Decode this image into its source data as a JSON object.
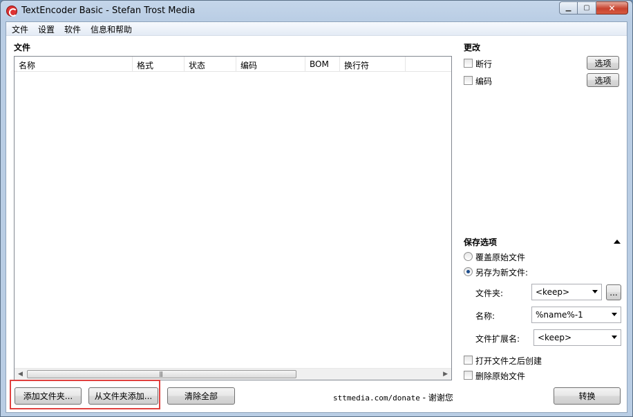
{
  "window": {
    "title": "TextEncoder Basic - Stefan Trost Media"
  },
  "menubar": {
    "items": [
      "文件",
      "设置",
      "软件",
      "信息和帮助"
    ]
  },
  "files_section": {
    "title": "文件",
    "columns": [
      "名称",
      "格式",
      "状态",
      "编码",
      "BOM",
      "换行符"
    ],
    "rows": []
  },
  "changes_section": {
    "title": "更改",
    "options": [
      {
        "label": "断行",
        "checked": false,
        "button": "选项"
      },
      {
        "label": "编码",
        "checked": false,
        "button": "选项"
      }
    ]
  },
  "save_section": {
    "title": "保存选项",
    "radio_overwrite": "覆盖原始文件",
    "radio_save_new": "另存为新文件:",
    "selected": "save_new",
    "folder_label": "文件夹:",
    "folder_value": "<keep>",
    "browse_label": "...",
    "name_label": "名称:",
    "name_value": "%name%-1",
    "ext_label": "文件扩展名:",
    "ext_value": "<keep>",
    "create_after_open": "打开文件之后创建",
    "delete_original": "删除原始文件"
  },
  "bottom": {
    "add_files": "添加文件夹...",
    "add_from_folder": "从文件夹添加...",
    "clear_all": "清除全部",
    "donate_url": "sttmedia.com/donate",
    "donate_thanks": " - 谢谢您",
    "convert": "转换"
  },
  "colors": {
    "highlight": "#e0403e",
    "accent": "#1d4d8c"
  }
}
